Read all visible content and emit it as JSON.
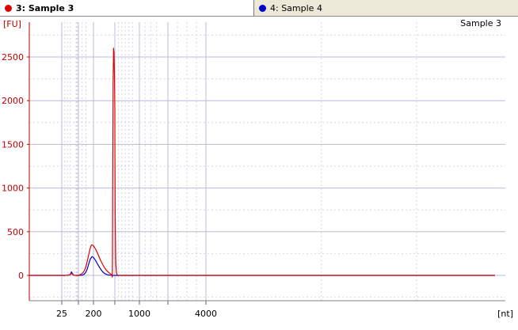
{
  "tabs": [
    {
      "label": "3: Sample 3",
      "color": "#e00000",
      "active": true
    },
    {
      "label": "4: Sample 4",
      "color": "#0000d0",
      "active": false
    }
  ],
  "chart_data": {
    "type": "line",
    "title": "Sample 3",
    "ylabel": "[FU]",
    "xlabel": "[nt]",
    "ylim": [
      -300,
      2900
    ],
    "yticks": [
      0,
      500,
      1000,
      1500,
      2000,
      2500
    ],
    "xticks": [
      "25",
      "200",
      "1000",
      "4000"
    ],
    "grid": true,
    "series": [
      {
        "name": "3: Sample 3",
        "color": "#e00000",
        "x": [
          25,
          30,
          35,
          40,
          42,
          44,
          46,
          50,
          55,
          60,
          65,
          70,
          80,
          90,
          100,
          110,
          120,
          130,
          140,
          150,
          160,
          170,
          175,
          180,
          185,
          190,
          200,
          210,
          220,
          230,
          240,
          250,
          260,
          270,
          275,
          280,
          285,
          287,
          288,
          289,
          290,
          292,
          294,
          296,
          298,
          300,
          303,
          306,
          310,
          315,
          320,
          330,
          340,
          350,
          360,
          380,
          400,
          450,
          500,
          520,
          530,
          535,
          540,
          545,
          550,
          555,
          560,
          565,
          570,
          580,
          590,
          600,
          620,
          650,
          700,
          1000
        ],
        "y": [
          0,
          0,
          2,
          8,
          25,
          10,
          2,
          0,
          0,
          0,
          0,
          0,
          0,
          0,
          2,
          6,
          15,
          30,
          55,
          100,
          170,
          250,
          290,
          320,
          345,
          350,
          340,
          300,
          250,
          190,
          140,
          95,
          60,
          35,
          25,
          15,
          8,
          5,
          -20,
          200,
          1100,
          2200,
          2600,
          2550,
          2300,
          1900,
          1400,
          1000,
          700,
          450,
          280,
          120,
          55,
          25,
          10,
          3,
          0,
          0,
          0,
          0,
          0,
          0,
          0,
          0,
          0,
          0,
          0,
          0,
          0,
          0,
          0,
          0,
          0,
          0,
          0,
          0
        ]
      },
      {
        "name": "4: Sample 4",
        "color": "#0000d0",
        "x": [
          25,
          30,
          35,
          40,
          42,
          44,
          46,
          50,
          60,
          80,
          100,
          120,
          130,
          140,
          150,
          160,
          170,
          180,
          190,
          200,
          210,
          220,
          230,
          240,
          250,
          260,
          270,
          280,
          290,
          300,
          320,
          350,
          400,
          500,
          600,
          700,
          800,
          900,
          1000
        ],
        "y": [
          0,
          0,
          2,
          10,
          40,
          15,
          2,
          0,
          0,
          0,
          0,
          2,
          5,
          15,
          40,
          80,
          140,
          190,
          215,
          205,
          170,
          125,
          85,
          50,
          25,
          12,
          5,
          2,
          0,
          0,
          0,
          0,
          0,
          0,
          0,
          0,
          0,
          0,
          0
        ]
      }
    ]
  }
}
